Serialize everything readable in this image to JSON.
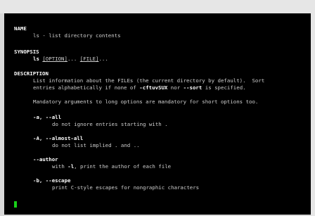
{
  "man": {
    "name_heading": "NAME",
    "name_desc": "ls - list directory contents",
    "synopsis_heading": "SYNOPSIS",
    "synopsis_cmd": "ls",
    "synopsis_opt": "[OPTION]",
    "synopsis_sep": "... ",
    "synopsis_file": "[FILE]",
    "synopsis_end": "...",
    "description_heading": "DESCRIPTION",
    "desc_line1": "List information about the FILEs (the current directory by default).  Sort",
    "desc_line2_a": "entries alphabetically if none of ",
    "desc_line2_b": "-cftuvSUX",
    "desc_line2_c": " nor ",
    "desc_line2_d": "--sort",
    "desc_line2_e": " is specified.",
    "mandatory": "Mandatory arguments to long options are mandatory for short options too.",
    "opt_a_flags": "-a, --all",
    "opt_a_desc": "do not ignore entries starting with .",
    "opt_A_flags": "-A, --almost-all",
    "opt_A_desc": "do not list implied . and ..",
    "opt_author_flags": "--author",
    "opt_author_desc_a": "with ",
    "opt_author_desc_b": "-l",
    "opt_author_desc_c": ", print the author of each file",
    "opt_b_flags": "-b, --escape",
    "opt_b_desc": "print C-style escapes for nongraphic characters"
  },
  "colors": {
    "background": "#000000",
    "text": "#cfcfcf",
    "bold": "#ffffff",
    "cursor": "#18d018"
  }
}
